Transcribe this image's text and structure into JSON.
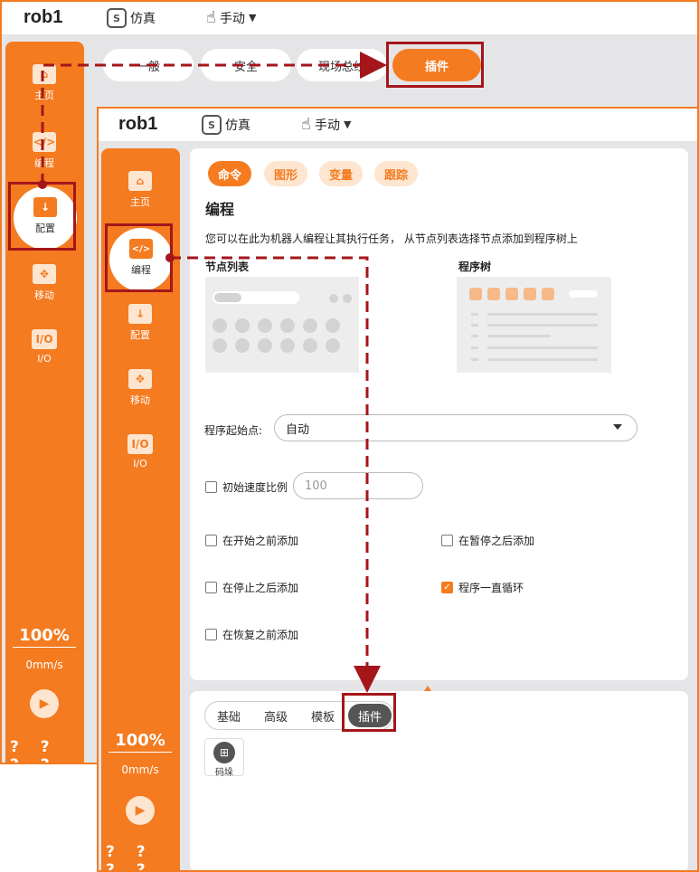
{
  "back": {
    "robot": "rob1",
    "sim_label": "仿真",
    "mode_label": "手动",
    "sidebar": [
      "主页",
      "编程",
      "配置",
      "移动",
      "I/O"
    ],
    "io_icon": "I/O",
    "speed_pct": "100%",
    "speed_val": "0mm/s",
    "help": "? ? ? ?",
    "tabs": [
      "一般",
      "安全",
      "现场总线",
      "插件"
    ]
  },
  "front": {
    "robot": "rob1",
    "sim_label": "仿真",
    "mode_label": "手动",
    "sidebar": [
      "主页",
      "编程",
      "配置",
      "移动",
      "I/O"
    ],
    "io_icon": "I/O",
    "speed_pct": "100%",
    "speed_val": "0mm/s",
    "help": "? ? ? ?",
    "cmd_tabs": [
      "命令",
      "图形",
      "变量",
      "跟踪"
    ],
    "section_title": "编程",
    "description": "您可以在此为机器人编程让其执行任务， 从节点列表选择节点添加到程序树上",
    "node_list_label": "节点列表",
    "program_tree_label": "程序树",
    "start_point_label": "程序起始点:",
    "start_point_value": "自动",
    "init_speed_label": "初始速度比例",
    "init_speed_placeholder": "100",
    "checks": [
      {
        "label": "在开始之前添加",
        "checked": false
      },
      {
        "label": "在暂停之后添加",
        "checked": false
      },
      {
        "label": "在停止之后添加",
        "checked": false
      },
      {
        "label": "程序一直循环",
        "checked": true
      },
      {
        "label": "在恢复之前添加",
        "checked": false
      }
    ],
    "categories": [
      "基础",
      "高级",
      "模板",
      "插件"
    ],
    "block_label": "码垛"
  },
  "colors": {
    "accent": "#f47b20",
    "highlight": "#a4161a"
  }
}
